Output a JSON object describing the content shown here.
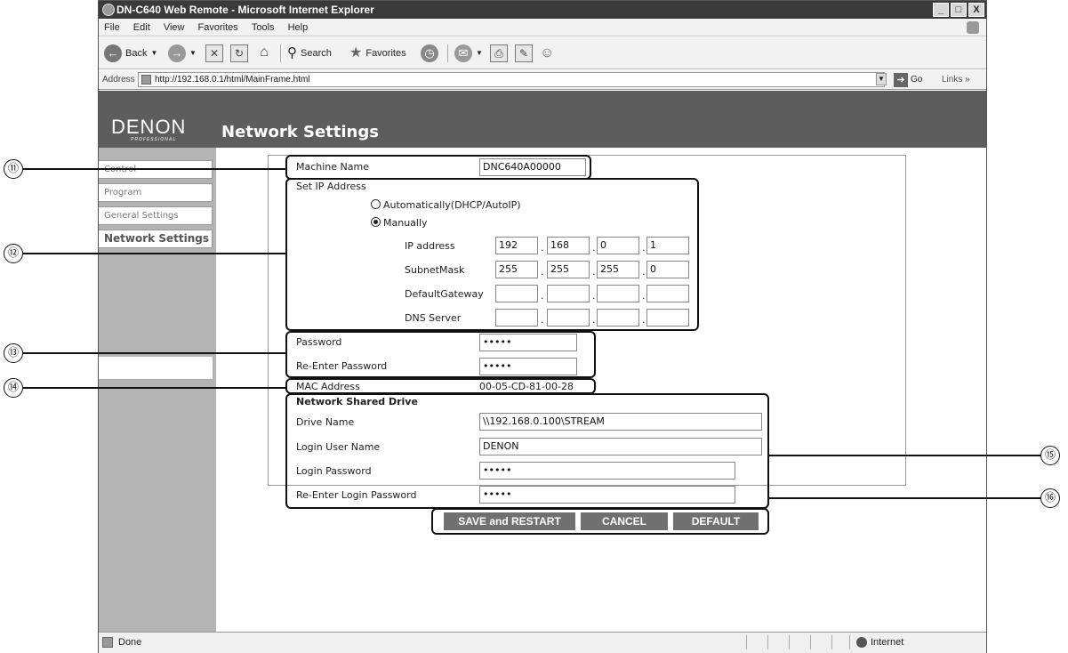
{
  "window": {
    "title": "DN-C640 Web Remote - Microsoft Internet Explorer",
    "controls": {
      "minimize": "_",
      "maximize": "□",
      "close": "X"
    }
  },
  "menu": [
    "File",
    "Edit",
    "View",
    "Favorites",
    "Tools",
    "Help"
  ],
  "toolbar": {
    "back": "Back",
    "search": "Search",
    "favorites": "Favorites"
  },
  "address": {
    "label": "Address",
    "url": "http://192.168.0.1/html/MainFrame.html",
    "go": "Go",
    "links": "Links"
  },
  "page": {
    "logo": "DENON",
    "logo_sub": "PROFESSIONAL",
    "title": "Network Settings"
  },
  "sidebar": {
    "items": [
      {
        "label": "Control"
      },
      {
        "label": "Program"
      },
      {
        "label": "General Settings"
      },
      {
        "label": "Network Settings"
      }
    ]
  },
  "form": {
    "machine_name_label": "Machine Name",
    "machine_name_value": "DNC640A00000",
    "set_ip_label": "Set IP Address",
    "auto_label": "Automatically(DHCP/AutoIP)",
    "manual_label": "Manually",
    "ip_label": "IP address",
    "ip": [
      "192",
      "168",
      "0",
      "1"
    ],
    "subnet_label": "SubnetMask",
    "subnet": [
      "255",
      "255",
      "255",
      "0"
    ],
    "gateway_label": "DefaultGateway",
    "gateway": [
      "",
      "",
      "",
      ""
    ],
    "dns_label": "DNS Server",
    "dns": [
      "",
      "",
      "",
      ""
    ],
    "password_label": "Password",
    "password_value": "•••••",
    "reenter_label": "Re-Enter Password",
    "reenter_value": "•••••",
    "mac_label": "MAC Address",
    "mac_value": "00-05-CD-81-00-28",
    "share_heading": "Network Shared Drive",
    "drive_label": "Drive Name",
    "drive_value": "\\\\192.168.0.100\\STREAM",
    "login_user_label": "Login User Name",
    "login_user_value": "DENON",
    "login_pw_label": "Login Password",
    "login_pw_value": "•••••",
    "login_pw2_label": "Re-Enter Login Password",
    "login_pw2_value": "•••••"
  },
  "buttons": {
    "save": "SAVE and RESTART",
    "cancel": "CANCEL",
    "default": "DEFAULT"
  },
  "status": {
    "text": "Done",
    "zone": "Internet"
  },
  "callouts": [
    "⑪",
    "⑫",
    "⑬",
    "⑭",
    "⑮",
    "⑯"
  ]
}
